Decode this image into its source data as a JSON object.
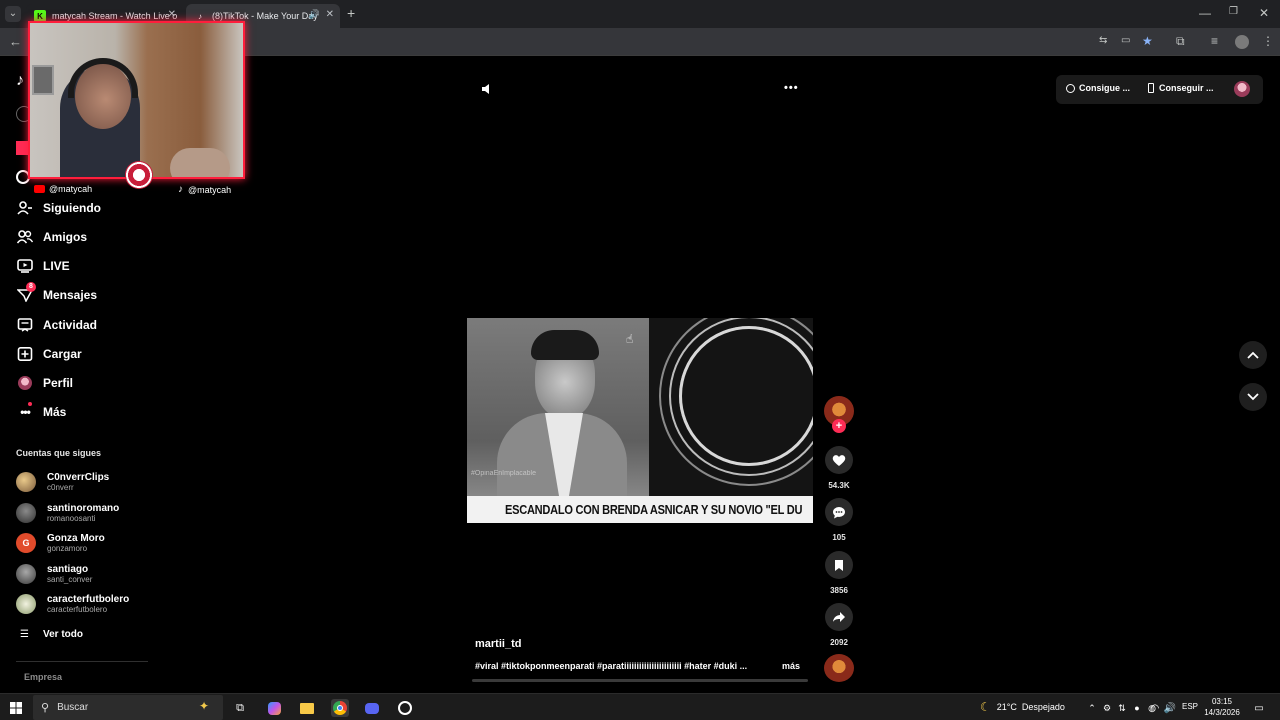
{
  "browser": {
    "tabs": [
      {
        "title": "matycah Stream - Watch Live o",
        "icon": "kick-icon"
      },
      {
        "title": "(8)TikTok - Make Your Day",
        "icon": "tiktok-icon"
      }
    ]
  },
  "webcam": {
    "handle_left": "@matycah",
    "handle_right": "@matycah"
  },
  "sidebar": {
    "items": [
      {
        "label": "Siguiendo",
        "icon": "following-icon"
      },
      {
        "label": "Amigos",
        "icon": "friends-icon"
      },
      {
        "label": "LIVE",
        "icon": "live-icon"
      },
      {
        "label": "Mensajes",
        "icon": "messages-icon",
        "badge": "8"
      },
      {
        "label": "Actividad",
        "icon": "activity-icon"
      },
      {
        "label": "Cargar",
        "icon": "upload-icon"
      },
      {
        "label": "Perfil",
        "icon": "profile-icon"
      },
      {
        "label": "Más",
        "icon": "more-icon"
      }
    ],
    "following_header": "Cuentas que sigues",
    "accounts": [
      {
        "name": "C0nverrClips",
        "handle": "c0nverr",
        "color": "#b48a5a",
        "initial": ""
      },
      {
        "name": "santinoromano",
        "handle": "romanoosanti",
        "color": "#555555",
        "initial": ""
      },
      {
        "name": "Gonza Moro",
        "handle": "gonzamoro",
        "color": "#e14b2b",
        "initial": "G"
      },
      {
        "name": "santiago",
        "handle": "santi_conver",
        "color": "#6b6b6b",
        "initial": ""
      },
      {
        "name": "caracterfutbolero",
        "handle": "caracterfutbolero",
        "color": "#8a9a6a",
        "initial": ""
      }
    ],
    "see_all": "Ver todo",
    "footer": "Empresa"
  },
  "header": {
    "coins_label": "Consigue ...",
    "app_label": "Conseguir ..."
  },
  "video": {
    "caption_banner": "ESCANDALO CON BRENDA ASNICAR Y SU NOVIO \"EL DU",
    "watermark": "#OpinaEnImplacable",
    "author": "martii_td",
    "description": "#viral #tiktokponmeenparati #paratiiiiiiiiiiiiiiiiiiiiiii #hater #duki ...",
    "more": "más"
  },
  "actions": {
    "likes": "54.3K",
    "comments": "105",
    "saves": "3856",
    "shares": "2092"
  },
  "taskbar": {
    "search_placeholder": "Buscar",
    "weather": "21°C  Despejado",
    "lang": "ESP",
    "time": "03:15",
    "date": "14/3/2026"
  },
  "colors": {
    "accent": "#fe2c55",
    "webcam_border": "#ff1e3c",
    "background": "#000000"
  }
}
